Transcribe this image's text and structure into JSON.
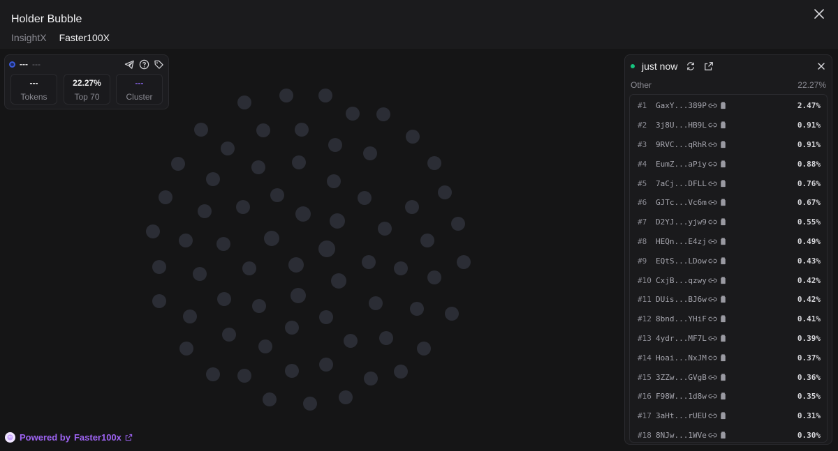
{
  "header": {
    "title": "Holder Bubble",
    "tabs": [
      "InsightX",
      "Faster100X"
    ],
    "active_tab": "Faster100X"
  },
  "stats": {
    "name": "---",
    "subname": "---",
    "tokens_value": "---",
    "tokens_label": "Tokens",
    "top_value": "22.27%",
    "top_label": "Top 70",
    "cluster_value": "---",
    "cluster_label": "Cluster"
  },
  "panel": {
    "time": "just now",
    "category": "Other",
    "category_pct": "22.27%",
    "holders": [
      {
        "rank": "#1",
        "addr": "GaxY...389P",
        "pct": "2.47%"
      },
      {
        "rank": "#2",
        "addr": "3j8U...HB9L",
        "pct": "0.91%"
      },
      {
        "rank": "#3",
        "addr": "9RVC...qRhR",
        "pct": "0.91%"
      },
      {
        "rank": "#4",
        "addr": "EumZ...aPiy",
        "pct": "0.88%"
      },
      {
        "rank": "#5",
        "addr": "7aCj...DFLL",
        "pct": "0.76%"
      },
      {
        "rank": "#6",
        "addr": "GJTc...Vc6m",
        "pct": "0.67%"
      },
      {
        "rank": "#7",
        "addr": "D2YJ...yjw9",
        "pct": "0.55%"
      },
      {
        "rank": "#8",
        "addr": "HEQn...E4zj",
        "pct": "0.49%"
      },
      {
        "rank": "#9",
        "addr": "EQtS...LDow",
        "pct": "0.43%"
      },
      {
        "rank": "#10",
        "addr": "CxjB...qzwy",
        "pct": "0.42%"
      },
      {
        "rank": "#11",
        "addr": "DUis...BJ6w",
        "pct": "0.42%"
      },
      {
        "rank": "#12",
        "addr": "8bnd...YHiF",
        "pct": "0.41%"
      },
      {
        "rank": "#13",
        "addr": "4ydr...MF7L",
        "pct": "0.39%"
      },
      {
        "rank": "#14",
        "addr": "Hoai...NxJM",
        "pct": "0.37%"
      },
      {
        "rank": "#15",
        "addr": "3ZZw...GVgB",
        "pct": "0.36%"
      },
      {
        "rank": "#16",
        "addr": "F98W...1d8w",
        "pct": "0.35%"
      },
      {
        "rank": "#17",
        "addr": "3aHt...rUEU",
        "pct": "0.31%"
      },
      {
        "rank": "#18",
        "addr": "8NJw...1WVe",
        "pct": "0.30%"
      }
    ]
  },
  "footer": {
    "prefix": "Powered by",
    "link": "Faster100x"
  },
  "colors": {
    "background": "#151516",
    "bubble": "#2b2d35",
    "accent_purple": "#9d63f2",
    "status_green": "#16c47f"
  }
}
